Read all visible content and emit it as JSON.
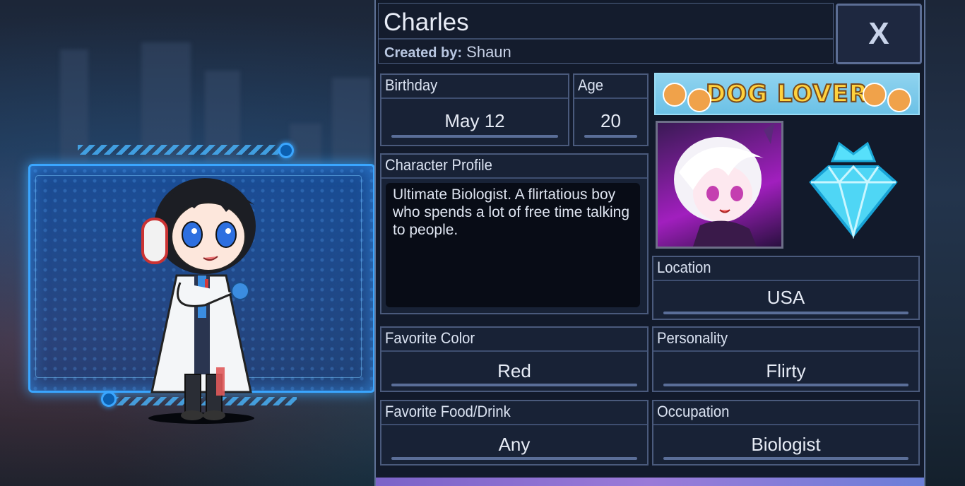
{
  "character": {
    "name": "Charles",
    "created_by_label": "Created by:",
    "creator": "Shaun"
  },
  "close_label": "X",
  "fields": {
    "birthday": {
      "label": "Birthday",
      "value": "May 12"
    },
    "age": {
      "label": "Age",
      "value": "20"
    },
    "profile": {
      "label": "Character Profile",
      "value": "Ultimate Biologist. A flirtatious boy who spends a lot of free time talking to people."
    },
    "location": {
      "label": "Location",
      "value": "USA"
    },
    "favorite_color": {
      "label": "Favorite Color",
      "value": "Red"
    },
    "personality": {
      "label": "Personality",
      "value": "Flirty"
    },
    "favorite_food": {
      "label": "Favorite Food/Drink",
      "value": "Any"
    },
    "occupation": {
      "label": "Occupation",
      "value": "Biologist"
    }
  },
  "badge": {
    "banner_text": "DOG LOVER",
    "icon": "diamond-icon",
    "color": "#4fd6f5"
  },
  "colors": {
    "panel": "#121a2b",
    "accent": "#3aa6ff",
    "text": "#e6ebf5"
  }
}
